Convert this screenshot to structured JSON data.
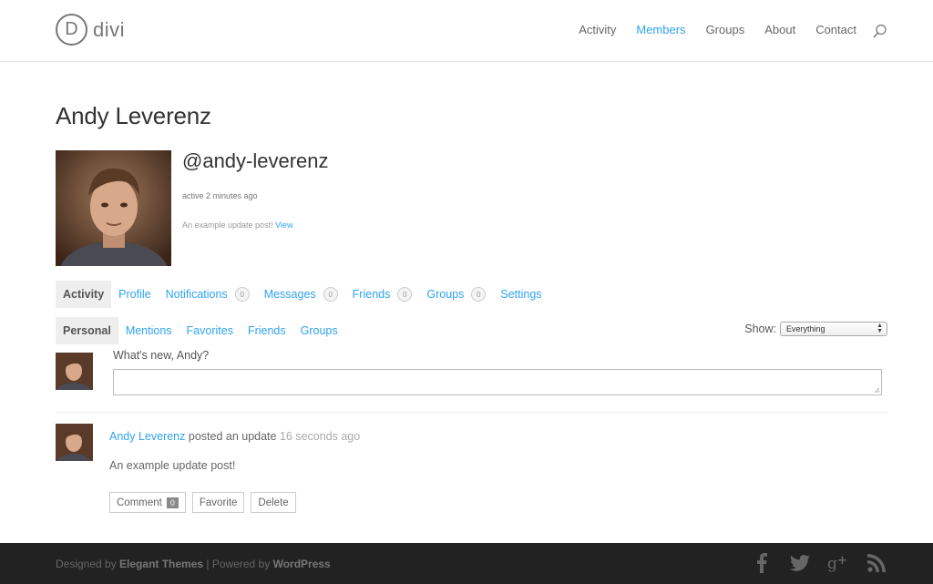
{
  "header": {
    "logo_letter": "D",
    "logo_text": "divi",
    "nav": [
      {
        "label": "Activity",
        "active": false
      },
      {
        "label": "Members",
        "active": true
      },
      {
        "label": "Groups",
        "active": false
      },
      {
        "label": "About",
        "active": false
      },
      {
        "label": "Contact",
        "active": false
      }
    ],
    "search_icon": "search-icon"
  },
  "profile": {
    "name": "Andy Leverenz",
    "handle": "@andy-leverenz",
    "active": "active 2 minutes ago",
    "latest_update": "An example update post!",
    "latest_update_link": "View"
  },
  "main_tabs": [
    {
      "label": "Activity",
      "count": null
    },
    {
      "label": "Profile",
      "count": null
    },
    {
      "label": "Notifications",
      "count": "0"
    },
    {
      "label": "Messages",
      "count": "0"
    },
    {
      "label": "Friends",
      "count": "0"
    },
    {
      "label": "Groups",
      "count": "0"
    },
    {
      "label": "Settings",
      "count": null
    }
  ],
  "sub_tabs": [
    "Personal",
    "Mentions",
    "Favorites",
    "Friends",
    "Groups"
  ],
  "filter": {
    "label": "Show:",
    "selected": "Everything"
  },
  "post_form": {
    "prompt": "What's new, Andy?"
  },
  "activity": {
    "author": "Andy Leverenz",
    "action": " posted an update ",
    "time": "16 seconds ago",
    "body": "An example update post!",
    "comment_label": "Comment",
    "comment_count": "0",
    "favorite_label": "Favorite",
    "delete_label": "Delete"
  },
  "footer": {
    "designed_by": "Designed by ",
    "designer": "Elegant Themes",
    "sep": " | Powered by ",
    "platform": "WordPress",
    "social": [
      "facebook-icon",
      "twitter-icon",
      "google-plus-icon",
      "rss-icon"
    ]
  },
  "colors": {
    "accent": "#2ea3f2",
    "footer_bg": "#222222"
  }
}
